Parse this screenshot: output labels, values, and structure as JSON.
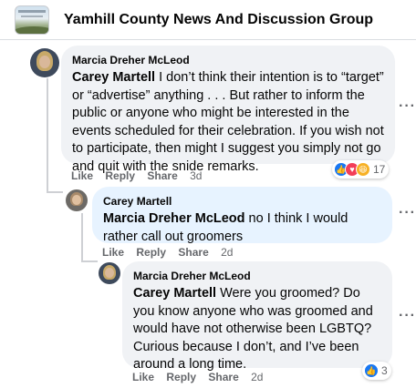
{
  "header": {
    "group_name": "Yamhill County News And Discussion Group"
  },
  "comments": [
    {
      "author": "Marcia Dreher McLeod",
      "mention": "Carey Martell",
      "text": " I don’t think their intention is to “target” or “advertise” anything . . . But rather to inform the public or anyone who might be interested in the events scheduled for their celebration. If you wish not to participate, then might I suggest you simply not go and quit with the snide remarks.",
      "actions": {
        "like": "Like",
        "reply": "Reply",
        "share": "Share",
        "time": "3d"
      },
      "reactions": {
        "icons": [
          "like-icon",
          "love-icon",
          "haha-icon"
        ],
        "count": "17"
      }
    },
    {
      "author": "Carey Martell",
      "mention": "Marcia Dreher McLeod",
      "text": " no I think I would rather call out groomers",
      "actions": {
        "like": "Like",
        "reply": "Reply",
        "share": "Share",
        "time": "2d"
      }
    },
    {
      "author": "Marcia Dreher McLeod",
      "mention": "Carey Martell",
      "text": " Were you groomed? Do you know anyone who was groomed and would have not otherwise been LGBTQ?Curious because I don’t, and I’ve been around a long time.",
      "actions": {
        "like": "Like",
        "reply": "Reply",
        "share": "Share",
        "time": "2d"
      },
      "reactions": {
        "icons": [
          "like-icon"
        ],
        "count": "3"
      }
    }
  ],
  "more_options": "···",
  "colors": {
    "bubble": "#f0f2f5",
    "highlight_bubble": "#e7f3ff",
    "like": "#1877f2",
    "love": "#f33e58",
    "haha": "#f7b125"
  }
}
